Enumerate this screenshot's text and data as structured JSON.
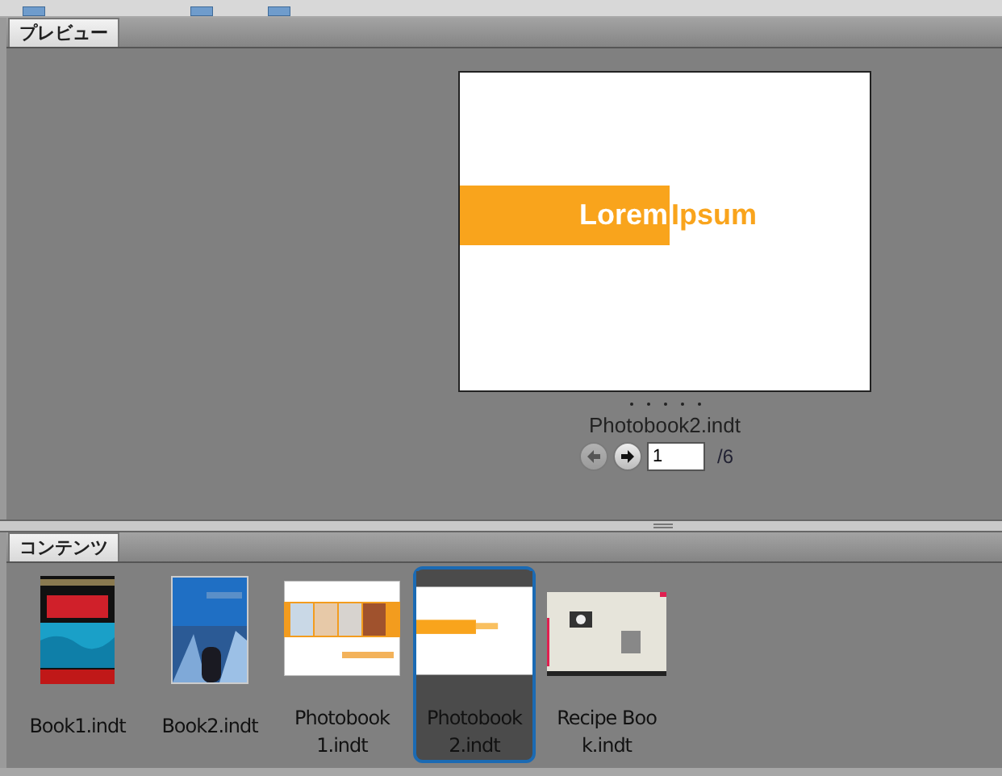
{
  "preview": {
    "tab": "プレビュー",
    "page": {
      "word_a": "Lorem",
      "word_b": "Ipsum"
    },
    "filename": "Photobook2.indt",
    "nav": {
      "prev_disabled": true,
      "next_disabled": false,
      "page": "1",
      "total": "/6"
    }
  },
  "content": {
    "tab": "コンテンツ",
    "items": [
      {
        "name": "Book1.indt",
        "kind": "dark-cover",
        "selected": false
      },
      {
        "name": "Book2.indt",
        "kind": "blue-cover",
        "selected": false
      },
      {
        "name": "Photobook 1.indt",
        "kind": "photo-strip",
        "selected": false
      },
      {
        "name": "Photobook 2.indt",
        "kind": "orange-bar",
        "selected": true
      },
      {
        "name": "Recipe Book.indt",
        "kind": "beige-page",
        "selected": false
      }
    ]
  }
}
